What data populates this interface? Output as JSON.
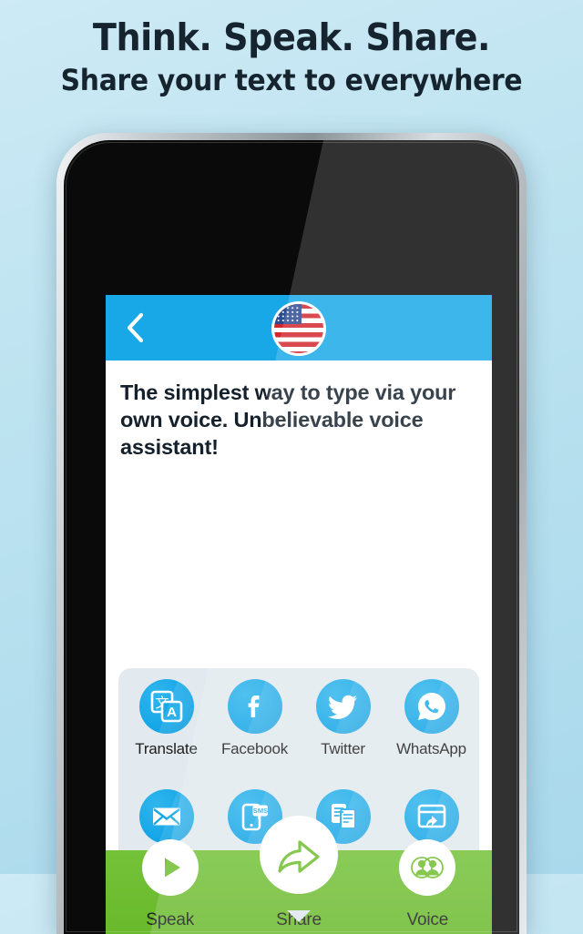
{
  "promo": {
    "title": "Think. Speak. Share.",
    "subtitle": "Share your text to everywhere"
  },
  "colors": {
    "background_top": "#cdeaf5",
    "background_bottom": "#a9d9ec",
    "navbar_blue": "#18a8e8",
    "icon_blue": "#18a8e8",
    "tabbar_green": "#6fbe2e",
    "panel_gray": "#e2eaef",
    "headline_navy": "#15242e"
  },
  "app": {
    "navbar": {
      "back_icon": "chevron-left-icon",
      "language_flag": "us-flag-icon",
      "language_name": "English (United States)"
    },
    "message": {
      "text": "The simplest way to type via your own voice. Unbelievable voice assistant!"
    },
    "share_panel": {
      "items": [
        {
          "label": "Translate",
          "icon": "translate-icon"
        },
        {
          "label": "Facebook",
          "icon": "facebook-icon"
        },
        {
          "label": "Twitter",
          "icon": "twitter-icon"
        },
        {
          "label": "WhatsApp",
          "icon": "whatsapp-icon"
        },
        {
          "label": "Email",
          "icon": "email-icon"
        },
        {
          "label": "SMS",
          "icon": "sms-icon"
        },
        {
          "label": "Copy",
          "icon": "copy-icon"
        },
        {
          "label": "Open In",
          "icon": "open-in-icon"
        }
      ]
    },
    "tabbar": {
      "items": [
        {
          "label": "Speak",
          "icon": "play-icon"
        },
        {
          "label": "Share",
          "icon": "share-arrow-icon"
        },
        {
          "label": "Voice",
          "icon": "two-people-icon"
        }
      ]
    }
  }
}
